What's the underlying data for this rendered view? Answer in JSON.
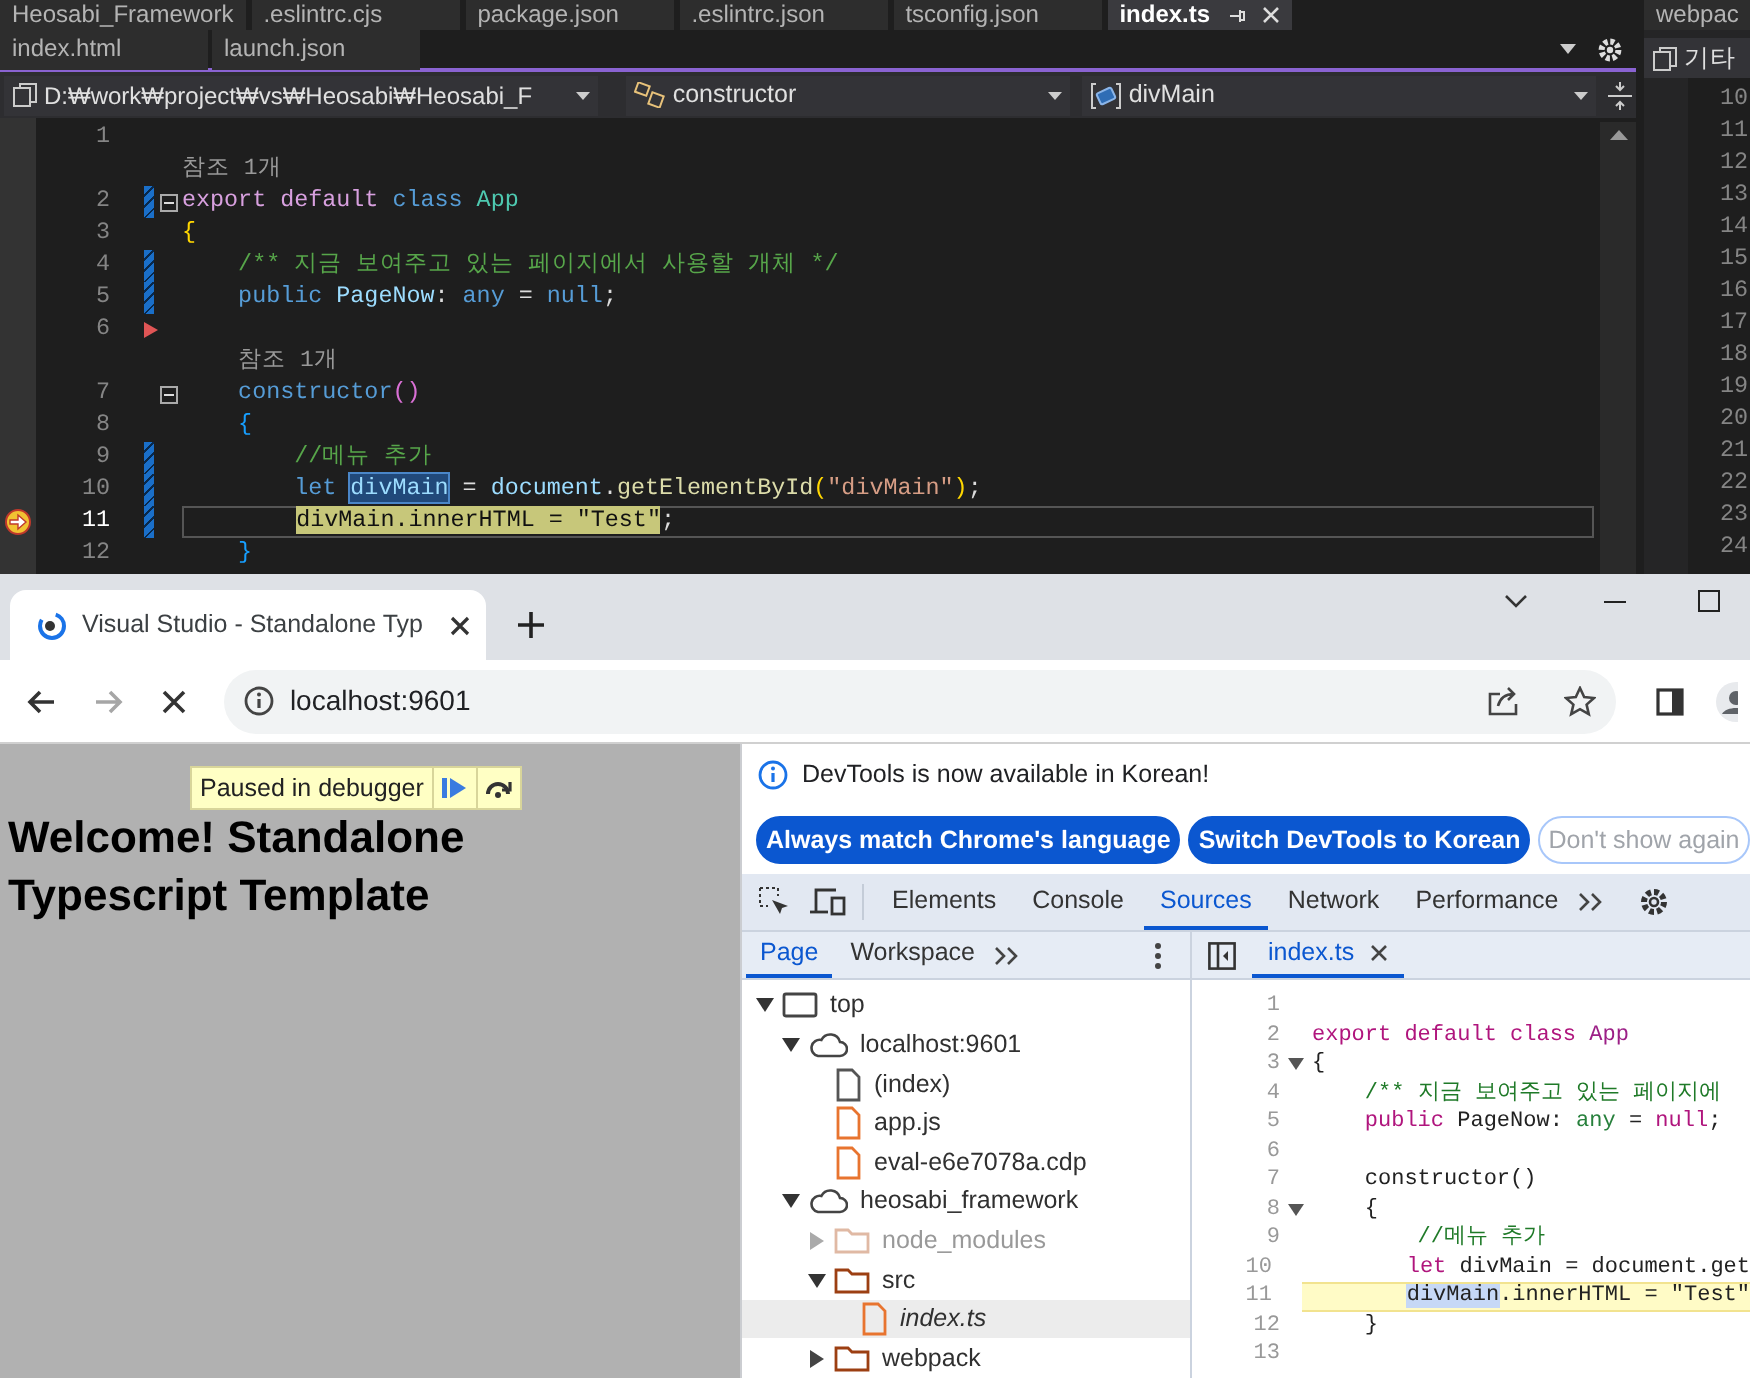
{
  "vs": {
    "tabs_row1": [
      {
        "label": "Heosabi_Framework",
        "selected": false
      },
      {
        "label": ".eslintrc.cjs",
        "selected": false
      },
      {
        "label": "package.json",
        "selected": false
      },
      {
        "label": ".eslintrc.json",
        "selected": false
      },
      {
        "label": "tsconfig.json",
        "selected": false
      },
      {
        "label": "index.ts",
        "selected": true
      }
    ],
    "tabs_row2": [
      {
        "label": "index.html",
        "selected": false
      },
      {
        "label": "launch.json",
        "selected": false
      }
    ],
    "nav": {
      "project": "D:₩work₩project₩vs₩Heosabi₩Heosabi_F",
      "member": "constructor",
      "symbol": "divMain"
    },
    "lines": [
      {
        "kind": "code",
        "number": "1",
        "changed": false,
        "current": false,
        "flagged": false
      },
      {
        "kind": "codelens",
        "text": "참조 1개"
      },
      {
        "kind": "code",
        "number": "2",
        "changed": true,
        "current": false,
        "flagged": false,
        "expanded": true,
        "tokens": [
          {
            "text": "export default",
            "kind": "control"
          },
          {
            "text": " class",
            "kind": "keyword"
          },
          {
            "text": " App",
            "kind": "type"
          }
        ]
      },
      {
        "kind": "code",
        "number": "3",
        "changed": false,
        "current": false,
        "flagged": false,
        "tokens": [
          {
            "text": "{",
            "kind": "bracket1"
          }
        ]
      },
      {
        "kind": "code",
        "number": "4",
        "changed": true,
        "current": false,
        "flagged": false,
        "tokens": [
          {
            "text": "    /** 지금 보여주고 있는 페이지에서 사용할 개체 */",
            "kind": "comment"
          }
        ]
      },
      {
        "kind": "code",
        "number": "5",
        "changed": true,
        "current": false,
        "flagged": false,
        "tokens": [
          {
            "text": "    public ",
            "kind": "keyword"
          },
          {
            "text": "PageNow",
            "kind": "variable"
          },
          {
            "text": ": ",
            "kind": "plain"
          },
          {
            "text": "any ",
            "kind": "keyword"
          },
          {
            "text": "= ",
            "kind": "plain"
          },
          {
            "text": "null",
            "kind": "keyword"
          },
          {
            "text": ";",
            "kind": "plain"
          }
        ]
      },
      {
        "kind": "code",
        "number": "6",
        "changed": false,
        "current": false,
        "flagged": true
      },
      {
        "kind": "codelens",
        "text": "참조 1개"
      },
      {
        "kind": "code",
        "number": "7",
        "changed": false,
        "current": false,
        "flagged": false,
        "expanded": true,
        "tokens": [
          {
            "text": "    constructor",
            "kind": "keyword"
          },
          {
            "text": "()",
            "kind": "bracket2"
          }
        ]
      },
      {
        "kind": "code",
        "number": "8",
        "changed": false,
        "current": false,
        "flagged": false,
        "tokens": [
          {
            "text": "    {",
            "kind": "bracket3"
          }
        ]
      },
      {
        "kind": "code",
        "number": "9",
        "changed": true,
        "current": false,
        "flagged": false,
        "tokens": [
          {
            "text": "        //메뉴 추가",
            "kind": "comment"
          }
        ]
      },
      {
        "kind": "code",
        "number": "10",
        "changed": true,
        "current": false,
        "flagged": false,
        "tokens": [
          {
            "text": "        let ",
            "kind": "keyword"
          },
          {
            "text": "divMain",
            "kind": "reference"
          },
          {
            "text": " = ",
            "kind": "plain"
          },
          {
            "text": "document",
            "kind": "variable"
          },
          {
            "text": ".",
            "kind": "plain"
          },
          {
            "text": "getElementById",
            "kind": "function"
          },
          {
            "text": "(",
            "kind": "bracket1"
          },
          {
            "text": "\"divMain\"",
            "kind": "string"
          },
          {
            "text": ")",
            "kind": "bracket1"
          },
          {
            "text": ";",
            "kind": "plain"
          }
        ]
      },
      {
        "kind": "code",
        "number": "11",
        "changed": true,
        "current": true,
        "flagged": false,
        "tokens": [
          {
            "text": "        divMain.innerHTML = \"Test\"",
            "kind": "statement"
          },
          {
            "text": ";",
            "kind": "plain"
          }
        ]
      },
      {
        "kind": "code",
        "number": "12",
        "changed": false,
        "current": false,
        "flagged": false,
        "tokens": [
          {
            "text": "    }",
            "kind": "bracket3"
          }
        ]
      }
    ],
    "side_panel": {
      "tab": "webpac",
      "button": "기타",
      "line_numbers": [
        "10",
        "11",
        "12",
        "13",
        "14",
        "15",
        "16",
        "17",
        "18",
        "19",
        "20",
        "21",
        "22",
        "23",
        "24"
      ]
    }
  },
  "browser": {
    "tab_title": "Visual Studio - Standalone Typ",
    "nav": [
      {
        "kind": "back",
        "disabled": false
      },
      {
        "kind": "forward",
        "disabled": true
      },
      {
        "kind": "stop",
        "disabled": false
      }
    ],
    "url": "localhost:9601",
    "page": {
      "paused_label": "Paused in debugger",
      "heading": "Welcome! Standalone Typescript Template"
    },
    "devtools": {
      "banner": "DevTools is now available in Korean!",
      "banner_buttons": [
        {
          "label": "Always match Chrome's language",
          "kind": "primary"
        },
        {
          "label": "Switch DevTools to Korean",
          "kind": "primary"
        },
        {
          "label": "Don't show again",
          "kind": "outline"
        }
      ],
      "tabs": [
        {
          "label": "Elements",
          "selected": false
        },
        {
          "label": "Console",
          "selected": false
        },
        {
          "label": "Sources",
          "selected": true
        },
        {
          "label": "Network",
          "selected": false
        },
        {
          "label": "Performance",
          "selected": false
        }
      ],
      "navigator_tabs": [
        {
          "label": "Page",
          "selected": true
        },
        {
          "label": "Workspace",
          "selected": false
        }
      ],
      "file_tabs": [
        {
          "label": "index.ts",
          "selected": true
        }
      ],
      "tree": [
        {
          "label": "top",
          "kind": "frame",
          "expanded": true,
          "selected": false,
          "children": [
            {
              "label": "localhost:9601",
              "kind": "cloud",
              "expanded": true,
              "selected": false,
              "children": [
                {
                  "label": "(index)",
                  "kind": "document",
                  "selected": false
                },
                {
                  "label": "app.js",
                  "kind": "script",
                  "selected": false
                },
                {
                  "label": "eval-e6e7078a.cdp",
                  "kind": "script",
                  "selected": false
                }
              ]
            },
            {
              "label": "heosabi_framework",
              "kind": "cloud",
              "expanded": true,
              "selected": false,
              "children": [
                {
                  "label": "node_modules",
                  "kind": "folder",
                  "expanded": false,
                  "dimmed": true,
                  "selected": false
                },
                {
                  "label": "src",
                  "kind": "folder",
                  "expanded": true,
                  "dimmed": false,
                  "selected": false,
                  "children": [
                    {
                      "label": "index.ts",
                      "kind": "script",
                      "selected": true
                    }
                  ]
                },
                {
                  "label": "webpack",
                  "kind": "folder",
                  "expanded": false,
                  "dimmed": false,
                  "selected": false
                }
              ]
            }
          ]
        }
      ],
      "code_lines": [
        {
          "number": "1",
          "current": false
        },
        {
          "number": "2",
          "current": false,
          "tokens": [
            {
              "text": "export default class",
              "kind": "keyword"
            },
            {
              "text": " App",
              "kind": "type"
            }
          ]
        },
        {
          "number": "3",
          "current": false,
          "expanded": true,
          "tokens": [
            {
              "text": "{",
              "kind": "plain"
            }
          ]
        },
        {
          "number": "4",
          "current": false,
          "tokens": [
            {
              "text": "    /** 지금 보여주고 있는 페이지에",
              "kind": "comment"
            }
          ]
        },
        {
          "number": "5",
          "current": false,
          "tokens": [
            {
              "text": "    public",
              "kind": "keyword"
            },
            {
              "text": " PageNow: ",
              "kind": "plain"
            },
            {
              "text": "any",
              "kind": "primitive"
            },
            {
              "text": " = ",
              "kind": "plain"
            },
            {
              "text": "null",
              "kind": "keyword"
            },
            {
              "text": ";",
              "kind": "plain"
            }
          ]
        },
        {
          "number": "6",
          "current": false
        },
        {
          "number": "7",
          "current": false,
          "tokens": [
            {
              "text": "    constructor()",
              "kind": "plain"
            }
          ]
        },
        {
          "number": "8",
          "current": false,
          "expanded": true,
          "tokens": [
            {
              "text": "    {",
              "kind": "plain"
            }
          ]
        },
        {
          "number": "9",
          "current": false,
          "tokens": [
            {
              "text": "        //메뉴 추가",
              "kind": "comment"
            }
          ]
        },
        {
          "number": "10",
          "current": false,
          "tokens": [
            {
              "text": "        let",
              "kind": "keyword"
            },
            {
              "text": " divMain = document.get",
              "kind": "plain"
            }
          ]
        },
        {
          "number": "11",
          "current": true,
          "tokens": [
            {
              "text": "        divMain",
              "kind": "selection"
            },
            {
              "text": ".innerHTML = \"Test\"",
              "kind": "plain"
            }
          ]
        },
        {
          "number": "12",
          "current": false,
          "tokens": [
            {
              "text": "    }",
              "kind": "plain"
            }
          ]
        },
        {
          "number": "13",
          "current": false
        }
      ]
    }
  }
}
